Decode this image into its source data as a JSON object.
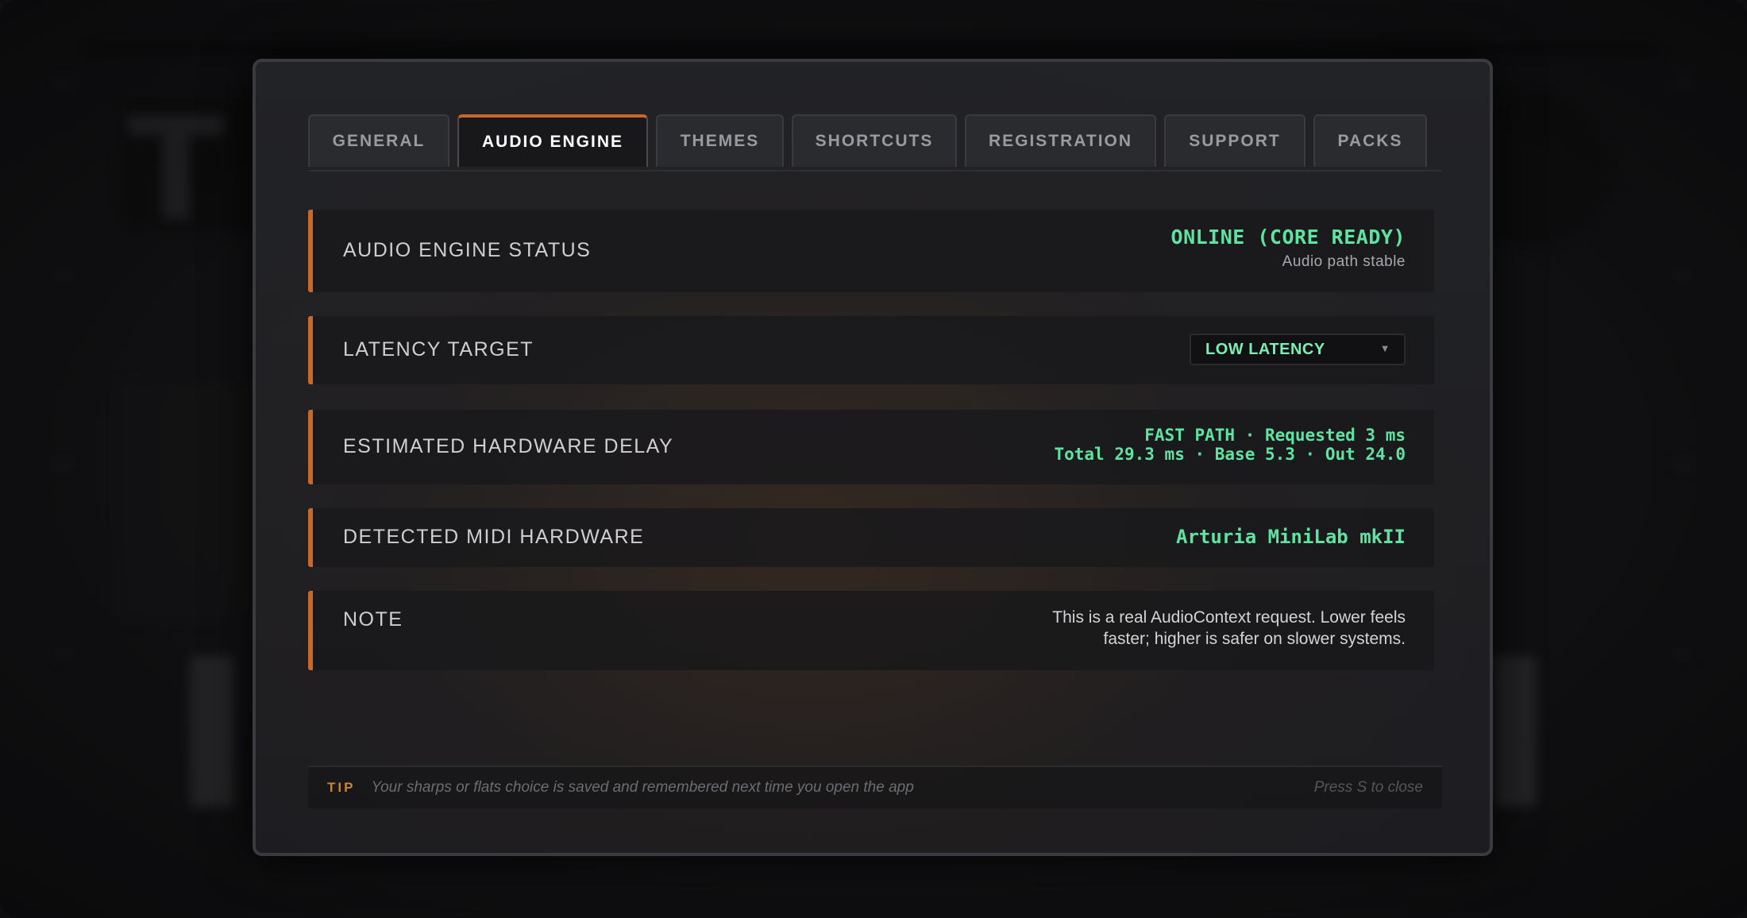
{
  "tabs": [
    {
      "label": "GENERAL",
      "active": false
    },
    {
      "label": "AUDIO ENGINE",
      "active": true
    },
    {
      "label": "THEMES",
      "active": false
    },
    {
      "label": "SHORTCUTS",
      "active": false
    },
    {
      "label": "REGISTRATION",
      "active": false
    },
    {
      "label": "SUPPORT",
      "active": false
    },
    {
      "label": "PACKS",
      "active": false
    }
  ],
  "engine_status": {
    "label": "AUDIO ENGINE STATUS",
    "value": "ONLINE (CORE READY)",
    "detail": "Audio path stable"
  },
  "latency": {
    "label": "LATENCY TARGET",
    "selected": "LOW LATENCY"
  },
  "hardware_delay": {
    "label": "ESTIMATED HARDWARE DELAY",
    "line1": "FAST PATH · Requested 3 ms",
    "line2": "Total 29.3 ms · Base 5.3 · Out 24.0"
  },
  "midi": {
    "label": "DETECTED MIDI HARDWARE",
    "device": "Arturia MiniLab mkII"
  },
  "note": {
    "label": "NOTE",
    "line1": "This is a real AudioContext request. Lower feels",
    "line2": "faster; higher is safer on slower systems."
  },
  "tip": {
    "label": "TIP",
    "text": "Your sharps or flats choice is saved and remembered next time you open the app",
    "close_hint": "Press S to close"
  },
  "colors": {
    "accent": "#c8692a",
    "value_green": "#5fe3a0",
    "tip_label": "#c8843a"
  }
}
